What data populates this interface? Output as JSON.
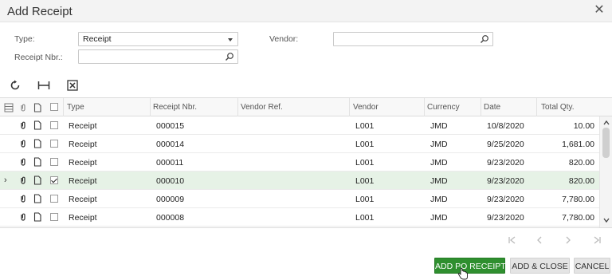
{
  "dialog": {
    "title": "Add Receipt"
  },
  "form": {
    "type_label": "Type:",
    "type_value": "Receipt",
    "vendor_label": "Vendor:",
    "vendor_value": "",
    "receipt_nbr_label": "Receipt Nbr.:",
    "receipt_nbr_value": ""
  },
  "toolbar": {
    "icons": [
      "refresh-icon",
      "fit-to-screen-icon",
      "export-to-excel-icon"
    ]
  },
  "grid": {
    "columns": [
      "Type",
      "Receipt Nbr.",
      "Vendor Ref.",
      "Vendor",
      "Currency",
      "Date",
      "Total Qty."
    ],
    "rows": [
      {
        "selected": false,
        "checked": false,
        "type": "Receipt",
        "receipt_nbr": "000015",
        "vendor_ref": "",
        "vendor": "L001",
        "currency": "JMD",
        "date": "10/8/2020",
        "total_qty": "10.00"
      },
      {
        "selected": false,
        "checked": false,
        "type": "Receipt",
        "receipt_nbr": "000014",
        "vendor_ref": "",
        "vendor": "L001",
        "currency": "JMD",
        "date": "9/25/2020",
        "total_qty": "1,681.00"
      },
      {
        "selected": false,
        "checked": false,
        "type": "Receipt",
        "receipt_nbr": "000011",
        "vendor_ref": "",
        "vendor": "L001",
        "currency": "JMD",
        "date": "9/23/2020",
        "total_qty": "820.00"
      },
      {
        "selected": true,
        "checked": true,
        "type": "Receipt",
        "receipt_nbr": "000010",
        "vendor_ref": "",
        "vendor": "L001",
        "currency": "JMD",
        "date": "9/23/2020",
        "total_qty": "820.00"
      },
      {
        "selected": false,
        "checked": false,
        "type": "Receipt",
        "receipt_nbr": "000009",
        "vendor_ref": "",
        "vendor": "L001",
        "currency": "JMD",
        "date": "9/23/2020",
        "total_qty": "7,780.00"
      },
      {
        "selected": false,
        "checked": false,
        "type": "Receipt",
        "receipt_nbr": "000008",
        "vendor_ref": "",
        "vendor": "L001",
        "currency": "JMD",
        "date": "9/23/2020",
        "total_qty": "7,780.00"
      }
    ]
  },
  "pager": {
    "icons": [
      "first-page-icon",
      "prev-page-icon",
      "next-page-icon",
      "last-page-icon"
    ]
  },
  "buttons": {
    "add_po_receipt": "ADD PO RECEIPT",
    "add_close": "ADD & CLOSE",
    "cancel": "CANCEL"
  },
  "colors": {
    "primary_button": "#2f8f2f",
    "selected_row": "#e6f2e6"
  }
}
